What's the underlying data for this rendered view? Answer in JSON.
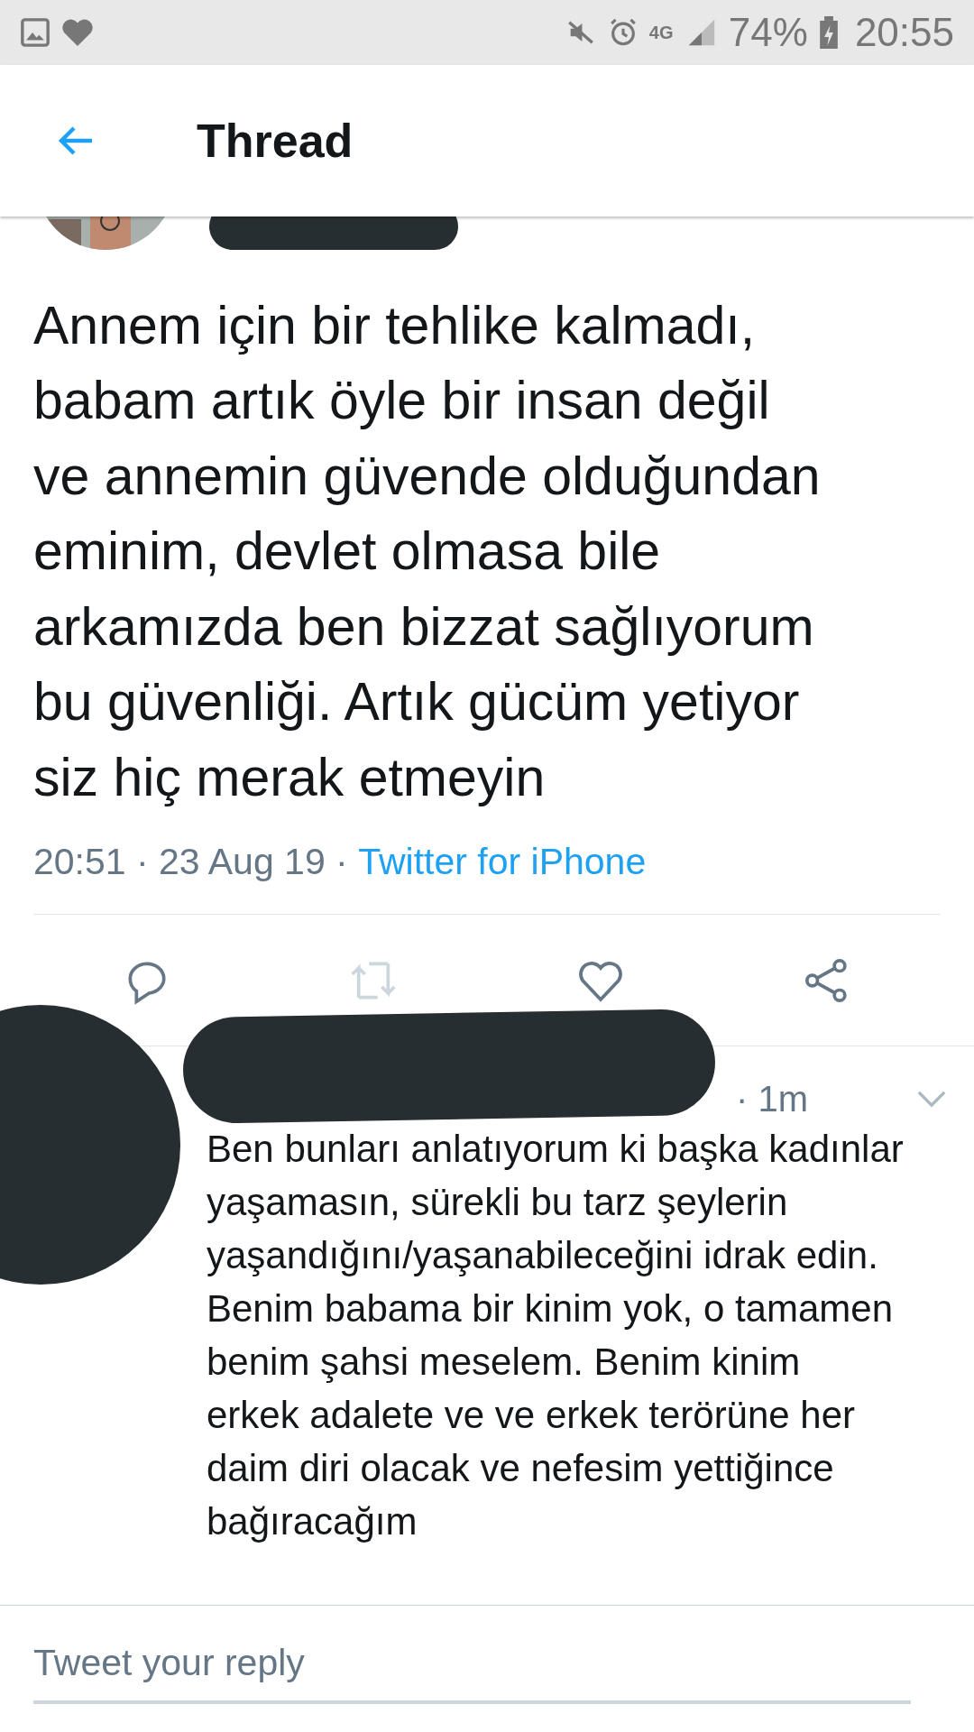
{
  "status_bar": {
    "network": "4G",
    "battery": "74%",
    "time": "20:55"
  },
  "header": {
    "title": "Thread"
  },
  "tweet": {
    "text": "Annem için bir tehlike kalmadı,\nbabam artık öyle bir insan değil\nve annemin güvende olduğundan\neminim, devlet olmasa bile\narkamızda ben bizzat sağlıyorum\nbu güvenliği. Artık gücüm yetiyor\nsiz hiç merak etmeyin",
    "timestamp": "20:51 · 23 Aug 19 ·",
    "source": "Twitter for iPhone",
    "retweet_disabled": true
  },
  "reply": {
    "age": "· 1m",
    "text": "Ben bunları anlatıyorum ki başka kadınlar\nyaşamasın, sürekli bu tarz şeylerin\nyaşandığını/yaşanabileceğini idrak edin.\nBenim babama bir kinim yok, o tamamen\nbenim şahsi meselem. Benim kinim\nerkek adalete ve ve erkek terörüne her\ndaim diri olacak ve nefesim yettiğince\nbağıracağım"
  },
  "composer": {
    "placeholder": "Tweet your reply"
  }
}
